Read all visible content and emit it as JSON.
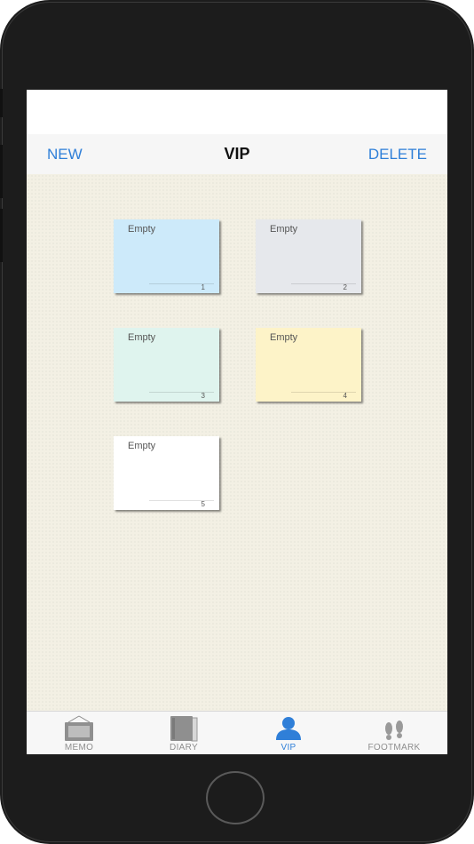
{
  "navbar": {
    "left_label": "NEW",
    "title": "VIP",
    "right_label": "DELETE"
  },
  "notes": [
    {
      "title": "Empty",
      "number": "1",
      "color": "#cdeafa"
    },
    {
      "title": "Empty",
      "number": "2",
      "color": "#e6e8ec"
    },
    {
      "title": "Empty",
      "number": "3",
      "color": "#dff4ee"
    },
    {
      "title": "Empty",
      "number": "4",
      "color": "#fdf3c8"
    },
    {
      "title": "Empty",
      "number": "5",
      "color": "#ffffff"
    }
  ],
  "tabbar": {
    "tabs": [
      {
        "label": "MEMO",
        "icon": "memo-frame-icon",
        "active": false
      },
      {
        "label": "DIARY",
        "icon": "diary-book-icon",
        "active": false
      },
      {
        "label": "VIP",
        "icon": "person-icon",
        "active": true
      },
      {
        "label": "FOOTMARK",
        "icon": "footprints-icon",
        "active": false
      }
    ]
  },
  "colors": {
    "accent": "#2f7fd8",
    "tab_inactive": "#8e8e8e",
    "background": "#f3f0e4"
  }
}
